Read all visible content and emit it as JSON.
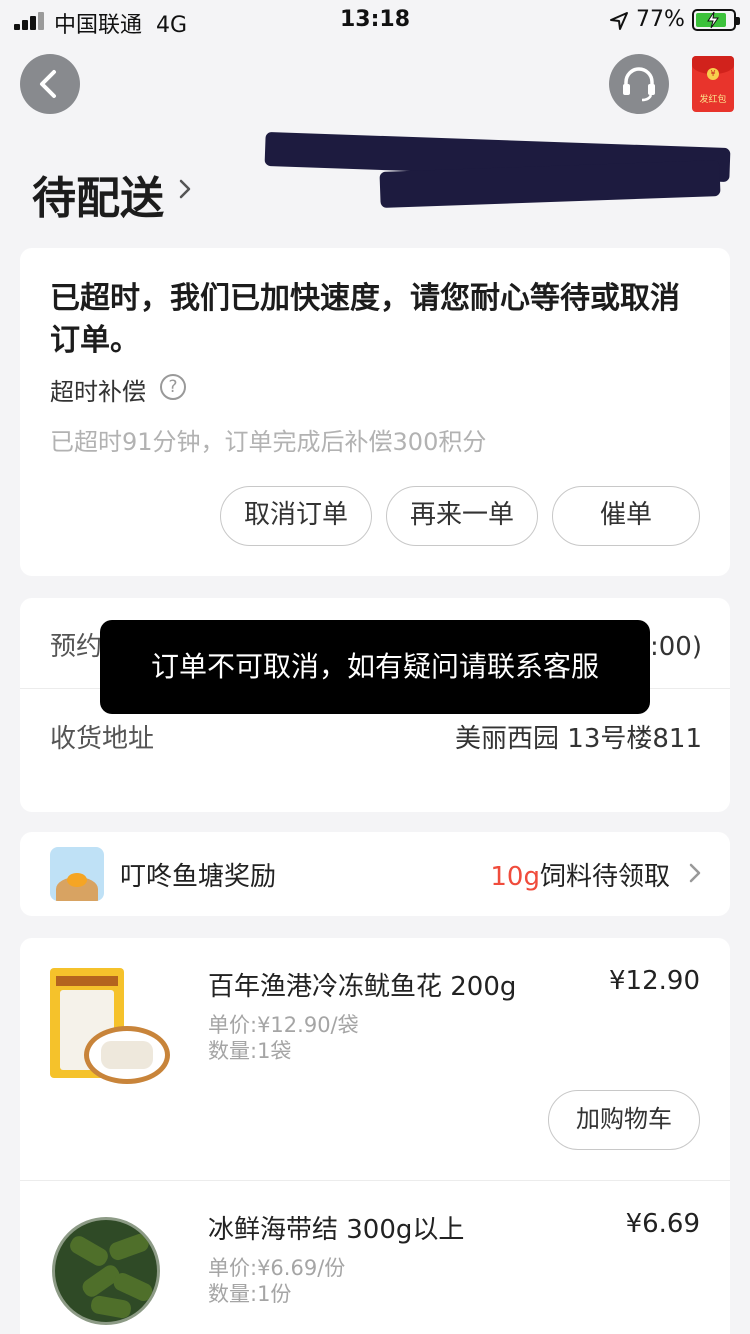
{
  "status_bar": {
    "carrier": "中国联通",
    "network": "4G",
    "time": "13:18",
    "battery": "77%"
  },
  "nav": {
    "redpacket_label": "发红包"
  },
  "page_title": "待配送",
  "status_card": {
    "message": "已超时，我们已加快速度，请您耐心等待或取消订单。",
    "compensation_label": "超时补偿",
    "compensation_detail": "已超时91分钟，订单完成后补偿300积分",
    "buttons": {
      "cancel": "取消订单",
      "reorder": "再来一单",
      "urge": "催单"
    }
  },
  "info_card": {
    "appointment_label": "预约时间",
    "appointment_value": "尽快送达 (预计13:00)",
    "address_label": "收货地址",
    "address_value": "美丽西园 13号楼811"
  },
  "toast": "订单不可取消，如有疑问请联系客服",
  "reward_card": {
    "title": "叮咚鱼塘奖励",
    "qty": "10g",
    "status": "饲料待领取"
  },
  "products": [
    {
      "name": "百年渔港冷冻鱿鱼花 200g",
      "price": "¥12.90",
      "unit_price": "单价:¥12.90/袋",
      "quantity": "数量:1袋",
      "cart_button": "加购物车"
    },
    {
      "name": "冰鲜海带结  300g以上",
      "price": "¥6.69",
      "unit_price": "单价:¥6.69/份",
      "quantity": "数量:1份"
    }
  ],
  "colors": {
    "background": "#f4f4f6",
    "accent_red": "#f04c3c",
    "battery_green": "#3cc13b",
    "muted_text": "#a5a5a5"
  }
}
